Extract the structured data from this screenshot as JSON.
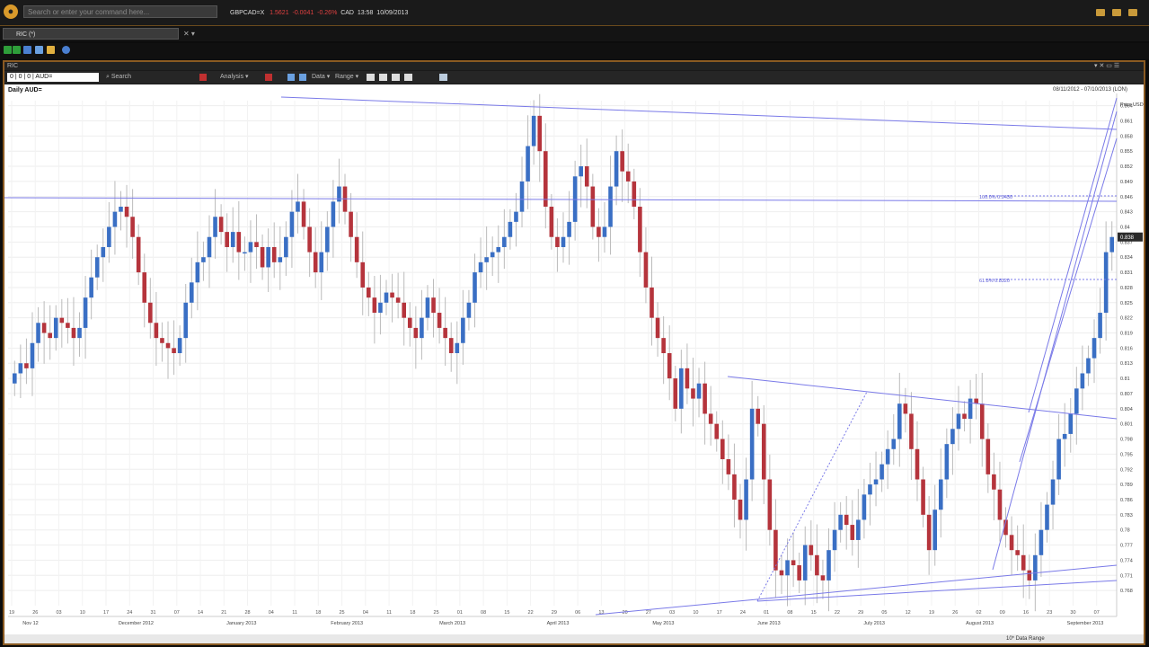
{
  "topbar": {
    "command_placeholder": "Search or enter your command here...",
    "ticker_symbol": "GBPCAD=X",
    "ticker_values": [
      "1.5621",
      "-0.0041",
      "-0.26%",
      "CAD",
      "13:58",
      "10/09/2013"
    ]
  },
  "tab": {
    "label": "RIC (*)"
  },
  "panel": {
    "title": "RIC"
  },
  "toolbar": {
    "symbol": "0 | 0 | 0 | AUD=",
    "search_label": "Search",
    "analysis_label": "Analysis",
    "data_label": "Data",
    "range_label": "Range"
  },
  "chart_title": "Daily AUD=",
  "date_range": "08/11/2012 - 07/10/2013 (LON)",
  "price_header": "Price USD",
  "bottom_status": "10* Data Range",
  "fib_labels": [
    "100.0% 0.9430",
    "61.8% 0.8320"
  ],
  "chart_data": {
    "type": "candlestick",
    "y_range": [
      0.765,
      0.865
    ],
    "y_ticks": [
      "0.864",
      "0.861",
      "0.858",
      "0.855",
      "0.852",
      "0.849",
      "0.846",
      "0.843",
      "0.84",
      "0.837",
      "0.834",
      "0.831",
      "0.828",
      "0.825",
      "0.822",
      "0.819",
      "0.816",
      "0.813",
      "0.81",
      "0.807",
      "0.804",
      "0.801",
      "0.798",
      "0.795",
      "0.792",
      "0.789",
      "0.786",
      "0.783",
      "0.78",
      "0.777",
      "0.774",
      "0.771",
      "0.768"
    ],
    "current_price": "0.838",
    "x_months": [
      "Nov 12",
      "December 2012",
      "January 2013",
      "February 2013",
      "March 2013",
      "April 2013",
      "May 2013",
      "June 2013",
      "July 2013",
      "August 2013",
      "September 2013"
    ],
    "x_day_ticks": [
      "19",
      "26",
      "03",
      "10",
      "17",
      "24",
      "31",
      "07",
      "14",
      "21",
      "28",
      "04",
      "11",
      "18",
      "25",
      "04",
      "11",
      "18",
      "25",
      "01",
      "08",
      "15",
      "22",
      "29",
      "06",
      "13",
      "20",
      "27",
      "03",
      "10",
      "17",
      "24",
      "01",
      "08",
      "15",
      "22",
      "29",
      "05",
      "12",
      "19",
      "26",
      "02",
      "09",
      "16",
      "23",
      "30",
      "07"
    ],
    "candles_close": [
      0.811,
      0.813,
      0.812,
      0.817,
      0.821,
      0.819,
      0.818,
      0.822,
      0.821,
      0.82,
      0.818,
      0.82,
      0.826,
      0.83,
      0.834,
      0.836,
      0.84,
      0.843,
      0.844,
      0.842,
      0.838,
      0.831,
      0.825,
      0.821,
      0.818,
      0.817,
      0.816,
      0.815,
      0.818,
      0.825,
      0.829,
      0.833,
      0.834,
      0.838,
      0.842,
      0.839,
      0.836,
      0.839,
      0.835,
      0.835,
      0.837,
      0.836,
      0.832,
      0.836,
      0.833,
      0.834,
      0.838,
      0.843,
      0.845,
      0.84,
      0.835,
      0.831,
      0.835,
      0.84,
      0.845,
      0.848,
      0.843,
      0.838,
      0.833,
      0.828,
      0.826,
      0.823,
      0.825,
      0.827,
      0.826,
      0.825,
      0.822,
      0.82,
      0.818,
      0.822,
      0.826,
      0.823,
      0.82,
      0.818,
      0.815,
      0.817,
      0.822,
      0.825,
      0.831,
      0.833,
      0.834,
      0.835,
      0.836,
      0.838,
      0.841,
      0.843,
      0.849,
      0.856,
      0.862,
      0.855,
      0.844,
      0.838,
      0.836,
      0.838,
      0.841,
      0.85,
      0.852,
      0.848,
      0.84,
      0.838,
      0.84,
      0.848,
      0.855,
      0.851,
      0.849,
      0.844,
      0.835,
      0.828,
      0.822,
      0.818,
      0.815,
      0.81,
      0.804,
      0.812,
      0.808,
      0.806,
      0.809,
      0.803,
      0.801,
      0.798,
      0.794,
      0.791,
      0.786,
      0.782,
      0.79,
      0.804,
      0.801,
      0.79,
      0.78,
      0.772,
      0.771,
      0.774,
      0.773,
      0.77,
      0.777,
      0.775,
      0.771,
      0.77,
      0.776,
      0.78,
      0.783,
      0.781,
      0.778,
      0.782,
      0.787,
      0.789,
      0.79,
      0.793,
      0.796,
      0.798,
      0.805,
      0.803,
      0.796,
      0.79,
      0.783,
      0.776,
      0.784,
      0.79,
      0.797,
      0.8,
      0.803,
      0.802,
      0.806,
      0.805,
      0.798,
      0.791,
      0.788,
      0.782,
      0.779,
      0.776,
      0.775,
      0.772,
      0.77,
      0.775,
      0.78,
      0.785,
      0.79,
      0.798,
      0.799,
      0.803,
      0.808,
      0.811,
      0.814,
      0.818,
      0.823,
      0.835,
      0.838
    ]
  },
  "colors": {
    "up": "#3a6fc4",
    "down": "#b5343c",
    "trend": "#7a7ae8",
    "hline": "#6f6fe0"
  }
}
